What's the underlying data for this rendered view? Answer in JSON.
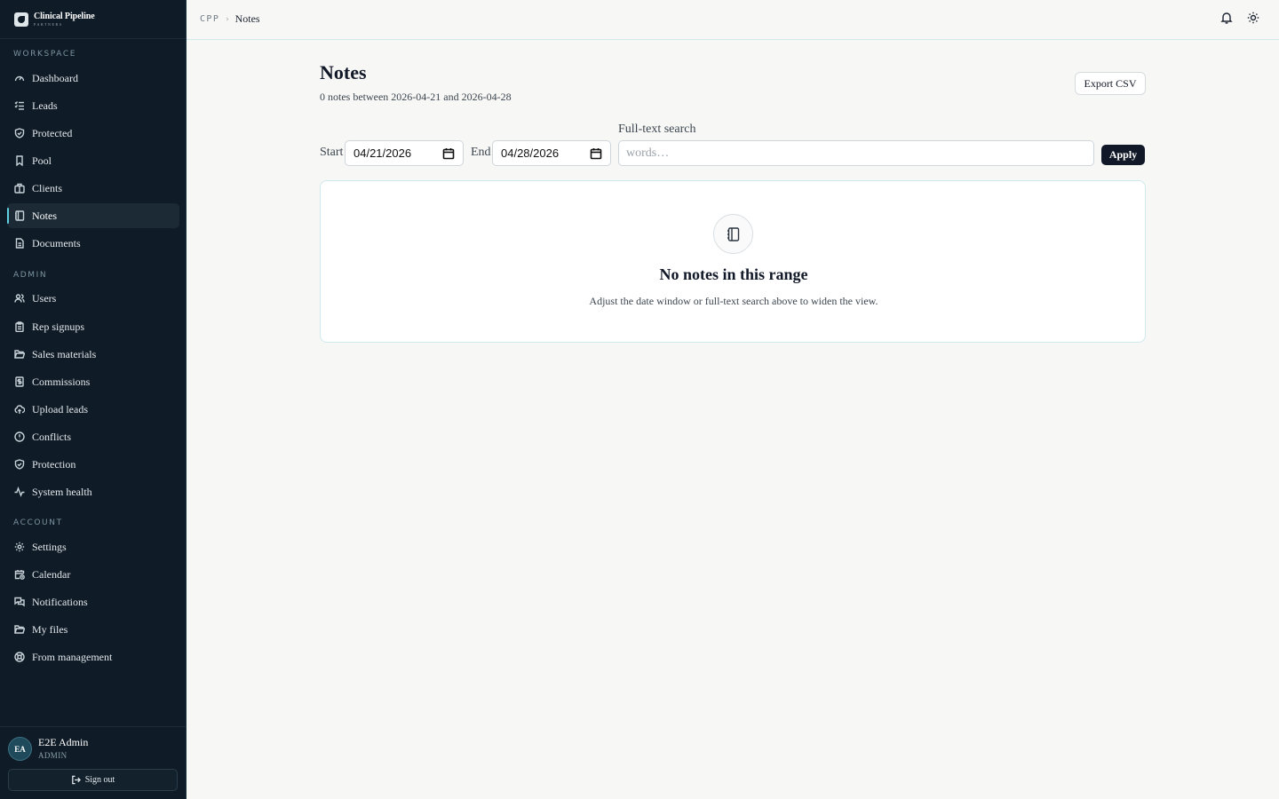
{
  "brand": {
    "name": "Clinical Pipeline",
    "sub": "PARTNERS"
  },
  "sidebar": {
    "sections": [
      {
        "label": "WORKSPACE"
      },
      {
        "label": "ADMIN"
      },
      {
        "label": "ACCOUNT"
      }
    ],
    "items": [
      {
        "label": "Dashboard",
        "icon": "gauge-icon"
      },
      {
        "label": "Leads",
        "icon": "checklist-icon"
      },
      {
        "label": "Protected",
        "icon": "shield-check-icon"
      },
      {
        "label": "Pool",
        "icon": "bookmark-icon"
      },
      {
        "label": "Clients",
        "icon": "building-icon"
      },
      {
        "label": "Notes",
        "icon": "notebook-icon",
        "active": true
      },
      {
        "label": "Documents",
        "icon": "document-icon"
      },
      {
        "label": "Users",
        "icon": "users-icon"
      },
      {
        "label": "Rep signups",
        "icon": "clipboard-icon"
      },
      {
        "label": "Sales materials",
        "icon": "folder-open-icon"
      },
      {
        "label": "Commissions",
        "icon": "receipt-icon"
      },
      {
        "label": "Upload leads",
        "icon": "cloud-upload-icon"
      },
      {
        "label": "Conflicts",
        "icon": "alert-circle-icon"
      },
      {
        "label": "Protection",
        "icon": "shield-check-icon"
      },
      {
        "label": "System health",
        "icon": "activity-icon"
      },
      {
        "label": "Settings",
        "icon": "gear-icon"
      },
      {
        "label": "Calendar",
        "icon": "calendar-clock-icon"
      },
      {
        "label": "Notifications",
        "icon": "messages-icon"
      },
      {
        "label": "My files",
        "icon": "folder-icon"
      },
      {
        "label": "From management",
        "icon": "lifebuoy-icon"
      }
    ]
  },
  "user": {
    "initials": "EA",
    "name": "E2E Admin",
    "role": "ADMIN",
    "signout_label": "Sign out"
  },
  "topbar": {
    "crumb_root": "CPP",
    "crumb_current": "Notes"
  },
  "main": {
    "title": "Notes",
    "subtitle": "0 notes between 2026-04-21 and 2026-04-28",
    "export_label": "Export CSV",
    "filters": {
      "start_label": "Start",
      "start_value": "04/21/2026",
      "end_label": "End",
      "end_value": "04/28/2026",
      "search_label": "Full-text search",
      "search_placeholder": "words…",
      "search_value": "",
      "apply_label": "Apply"
    },
    "empty": {
      "title": "No notes in this range",
      "description": "Adjust the date window or full-text search above to widen the view."
    }
  },
  "colors": {
    "sidebar_bg": "#0f1b26",
    "accent": "#5ccfe0",
    "page_bg": "#f7f7f5",
    "primary_button": "#111827"
  }
}
